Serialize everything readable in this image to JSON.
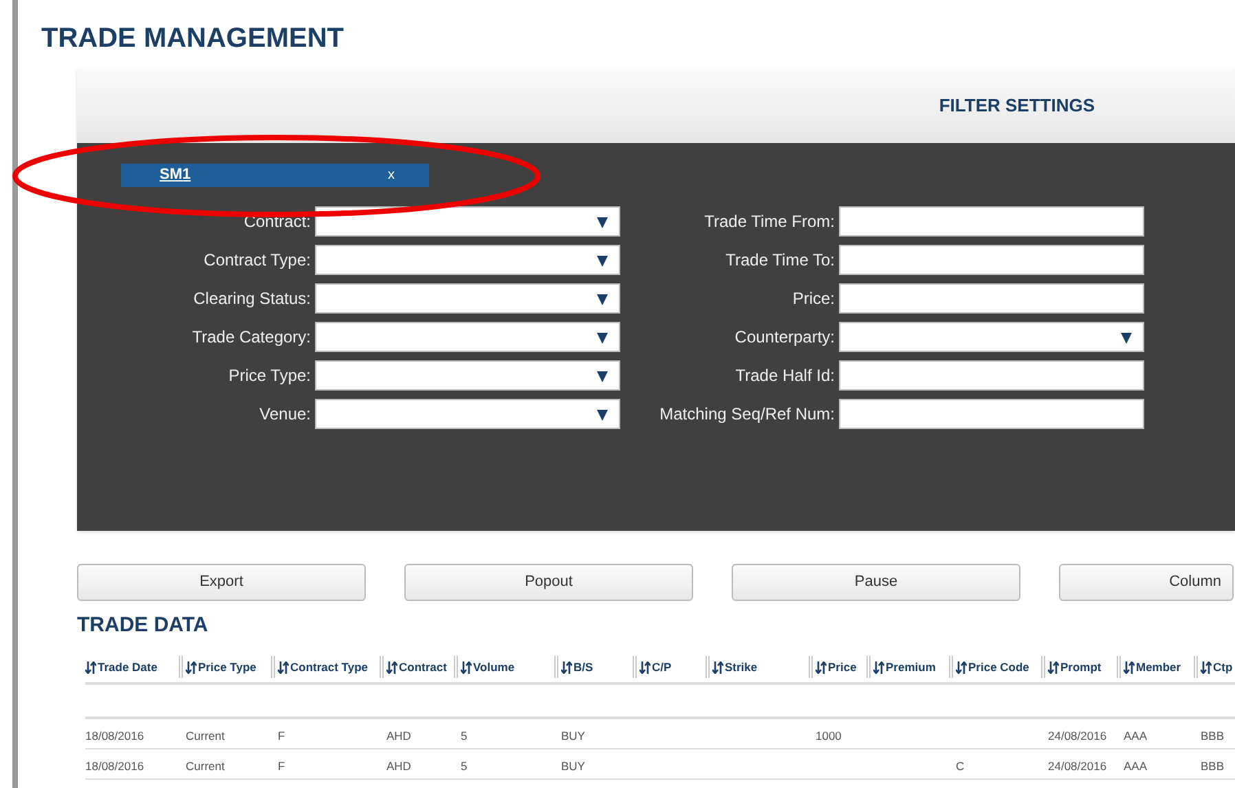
{
  "page_title": "TRADE MANAGEMENT",
  "filter_panel": {
    "title": "FILTER SETTINGS",
    "chips": [
      {
        "label": "SM1",
        "remove": "x"
      }
    ],
    "left_fields": [
      {
        "label": "Contract:",
        "kind": "dropdown"
      },
      {
        "label": "Contract Type:",
        "kind": "dropdown"
      },
      {
        "label": "Clearing Status:",
        "kind": "dropdown"
      },
      {
        "label": "Trade Category:",
        "kind": "dropdown"
      },
      {
        "label": "Price Type:",
        "kind": "dropdown"
      },
      {
        "label": "Venue:",
        "kind": "dropdown"
      }
    ],
    "right_fields": [
      {
        "label": "Trade Time From:",
        "kind": "text"
      },
      {
        "label": "Trade Time To:",
        "kind": "text"
      },
      {
        "label": "Price:",
        "kind": "text"
      },
      {
        "label": "Counterparty:",
        "kind": "dropdown"
      },
      {
        "label": "Trade Half Id:",
        "kind": "text"
      },
      {
        "label": "Matching Seq/Ref Num:",
        "kind": "text"
      }
    ]
  },
  "buttons": [
    "Export",
    "Popout",
    "Pause",
    "Column"
  ],
  "trade_data": {
    "title": "TRADE DATA",
    "columns": [
      "Trade Date",
      "Price Type",
      "Contract Type",
      "Contract",
      "Volume",
      "B/S",
      "C/P",
      "Strike",
      "Price",
      "Premium",
      "Price Code",
      "Prompt",
      "Member",
      "Ctp"
    ],
    "rows": [
      [
        "18/08/2016",
        "Current",
        "F",
        "AHD",
        "5",
        "BUY",
        null,
        null,
        "1000",
        null,
        null,
        "24/08/2016",
        "AAA",
        "BBB"
      ],
      [
        "18/08/2016",
        "Current",
        "F",
        "AHD",
        "5",
        "BUY",
        null,
        null,
        null,
        null,
        "C",
        "24/08/2016",
        "AAA",
        "BBB"
      ]
    ]
  }
}
